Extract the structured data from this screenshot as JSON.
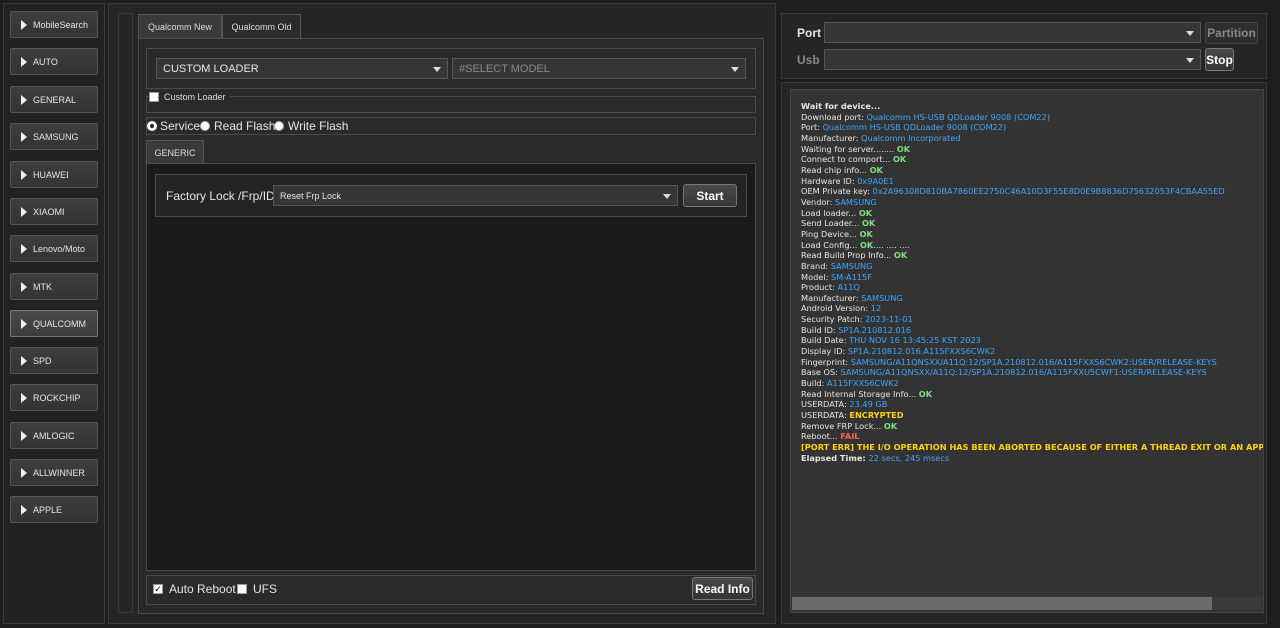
{
  "sidebar": {
    "items": [
      {
        "label": "MobileSearch"
      },
      {
        "label": "AUTO"
      },
      {
        "label": "GENERAL"
      },
      {
        "label": "SAMSUNG"
      },
      {
        "label": "HUAWEI"
      },
      {
        "label": "XIAOMI"
      },
      {
        "label": "Lenovo/Moto"
      },
      {
        "label": "MTK"
      },
      {
        "label": "QUALCOMM"
      },
      {
        "label": "SPD"
      },
      {
        "label": "ROCKCHIP"
      },
      {
        "label": "AMLOGIC"
      },
      {
        "label": "ALLWINNER"
      },
      {
        "label": "APPLE"
      }
    ],
    "active": "QUALCOMM"
  },
  "tabs": {
    "new": "Qualcomm New",
    "old": "Qualcomm Old",
    "active": "Qualcomm New"
  },
  "loader_select": {
    "value": "CUSTOM LOADER"
  },
  "model_select": {
    "placeholder": "#SELECT MODEL"
  },
  "custom_loader": {
    "label": "Custom Loader",
    "checked": false
  },
  "mode": {
    "service": "Service",
    "read_flash": "Read Flash",
    "write_flash": "Write Flash",
    "selected": "Service"
  },
  "inner_tab": {
    "label": "GENERIC"
  },
  "frp": {
    "label": "Factory Lock /Frp/ID",
    "option": "Reset Frp Lock",
    "start": "Start"
  },
  "footer": {
    "auto_reboot": "Auto Reboot",
    "auto_reboot_checked": true,
    "ufs": "UFS",
    "ufs_checked": false,
    "read_info": "Read Info"
  },
  "connection": {
    "port_label": "Port",
    "usb_label": "Usb",
    "partition": "Partition",
    "stop": "Stop"
  },
  "colors": {
    "info": "#3ea6ff",
    "ok": "#7fe07f",
    "warn": "#ffd11a",
    "fail": "#ff6060"
  },
  "log": [
    [
      {
        "t": "Wait for device...",
        "c": "w",
        "b": true
      }
    ],
    [
      {
        "t": "Download port: ",
        "c": "w"
      },
      {
        "t": "Qualcomm HS-USB QDLoader 9008 (COM22)",
        "c": "b"
      }
    ],
    [
      {
        "t": "Port: ",
        "c": "w"
      },
      {
        "t": "Qualcomm HS-USB QDLoader 9008 (COM22)",
        "c": "b"
      }
    ],
    [
      {
        "t": "Manufacturer: ",
        "c": "w"
      },
      {
        "t": "Qualcomm Incorporated",
        "c": "b"
      }
    ],
    [
      {
        "t": "Waiting for server........ ",
        "c": "w"
      },
      {
        "t": "OK",
        "c": "g"
      }
    ],
    [
      {
        "t": "Connect to comport... ",
        "c": "w"
      },
      {
        "t": "OK",
        "c": "g"
      }
    ],
    [
      {
        "t": "Read chip info... ",
        "c": "w"
      },
      {
        "t": "OK",
        "c": "g"
      }
    ],
    [
      {
        "t": "Hardware ID: ",
        "c": "w"
      },
      {
        "t": "0x9A0E1",
        "c": "b"
      }
    ],
    [
      {
        "t": "OEM Private key: ",
        "c": "w"
      },
      {
        "t": "0x2A96308D810BA7860EE2750C46A10D3F55E8D0E9B8836D75632053F4CBAA55ED",
        "c": "b"
      }
    ],
    [
      {
        "t": "Vendor: ",
        "c": "w"
      },
      {
        "t": "SAMSUNG",
        "c": "b"
      }
    ],
    [
      {
        "t": "Load loader... ",
        "c": "w"
      },
      {
        "t": "OK",
        "c": "g"
      }
    ],
    [
      {
        "t": "Send Loader... ",
        "c": "w"
      },
      {
        "t": "OK",
        "c": "g"
      }
    ],
    [
      {
        "t": "Ping Device... ",
        "c": "w"
      },
      {
        "t": "OK",
        "c": "g"
      }
    ],
    [
      {
        "t": "Load Config... ",
        "c": "w"
      },
      {
        "t": "OK",
        "c": "g"
      },
      {
        "t": ".... .... ....",
        "c": "w"
      }
    ],
    [
      {
        "t": "Read Build Prop Info... ",
        "c": "w"
      },
      {
        "t": "OK",
        "c": "g"
      }
    ],
    [
      {
        "t": " Brand: ",
        "c": "w"
      },
      {
        "t": "SAMSUNG",
        "c": "b"
      }
    ],
    [
      {
        "t": " Model: ",
        "c": "w"
      },
      {
        "t": "SM-A115F",
        "c": "b"
      }
    ],
    [
      {
        "t": " Product: ",
        "c": "w"
      },
      {
        "t": "A11Q",
        "c": "b"
      }
    ],
    [
      {
        "t": " Manufacturer: ",
        "c": "w"
      },
      {
        "t": "SAMSUNG",
        "c": "b"
      }
    ],
    [
      {
        "t": " Android Version: ",
        "c": "w"
      },
      {
        "t": "12",
        "c": "b"
      }
    ],
    [
      {
        "t": " Security Patch: ",
        "c": "w"
      },
      {
        "t": "2023-11-01",
        "c": "b"
      }
    ],
    [
      {
        "t": " Build ID: ",
        "c": "w"
      },
      {
        "t": "SP1A.210812.016",
        "c": "b"
      }
    ],
    [
      {
        "t": " Build Date: ",
        "c": "w"
      },
      {
        "t": "THU NOV 16 13:45:25 KST 2023",
        "c": "b"
      }
    ],
    [
      {
        "t": " Display ID: ",
        "c": "w"
      },
      {
        "t": "SP1A.210812.016.A115FXXS6CWK2",
        "c": "b"
      }
    ],
    [
      {
        "t": " Fingerprint: ",
        "c": "w"
      },
      {
        "t": "SAMSUNG/A11QNSXX/A11Q:12/SP1A.210812.016/A115FXXS6CWK2:USER/RELEASE-KEYS",
        "c": "b"
      }
    ],
    [
      {
        "t": " Base OS: ",
        "c": "w"
      },
      {
        "t": "SAMSUNG/A11QNSXX/A11Q:12/SP1A.210812.016/A115FXXU5CWF1:USER/RELEASE-KEYS",
        "c": "b"
      }
    ],
    [
      {
        "t": " Build: ",
        "c": "w"
      },
      {
        "t": "A115FXXS6CWK2",
        "c": "b"
      }
    ],
    [
      {
        "t": "Read Internal Storage Info... ",
        "c": "w"
      },
      {
        "t": "OK",
        "c": "g"
      }
    ],
    [
      {
        "t": "USERDATA: ",
        "c": "w"
      },
      {
        "t": "23.49 GB",
        "c": "b"
      }
    ],
    [
      {
        "t": "USERDATA: ",
        "c": "w"
      },
      {
        "t": "ENCRYPTED",
        "c": "y"
      }
    ],
    [
      {
        "t": "Remove FRP Lock... ",
        "c": "w"
      },
      {
        "t": "OK",
        "c": "g"
      }
    ],
    [
      {
        "t": "Reboot... ",
        "c": "w"
      },
      {
        "t": "FAIL",
        "c": "r"
      }
    ],
    [
      {
        "t": "  [PORT ERR] THE I/O OPERATION HAS BEEN ABORTED BECAUSE OF EITHER A THREAD EXIT OR AN APPLICATION REQUEST",
        "c": "y"
      }
    ],
    [
      {
        "t": "Elapsed Time: ",
        "c": "w",
        "b": true
      },
      {
        "t": "22 secs, 245 msecs",
        "c": "b"
      }
    ]
  ]
}
